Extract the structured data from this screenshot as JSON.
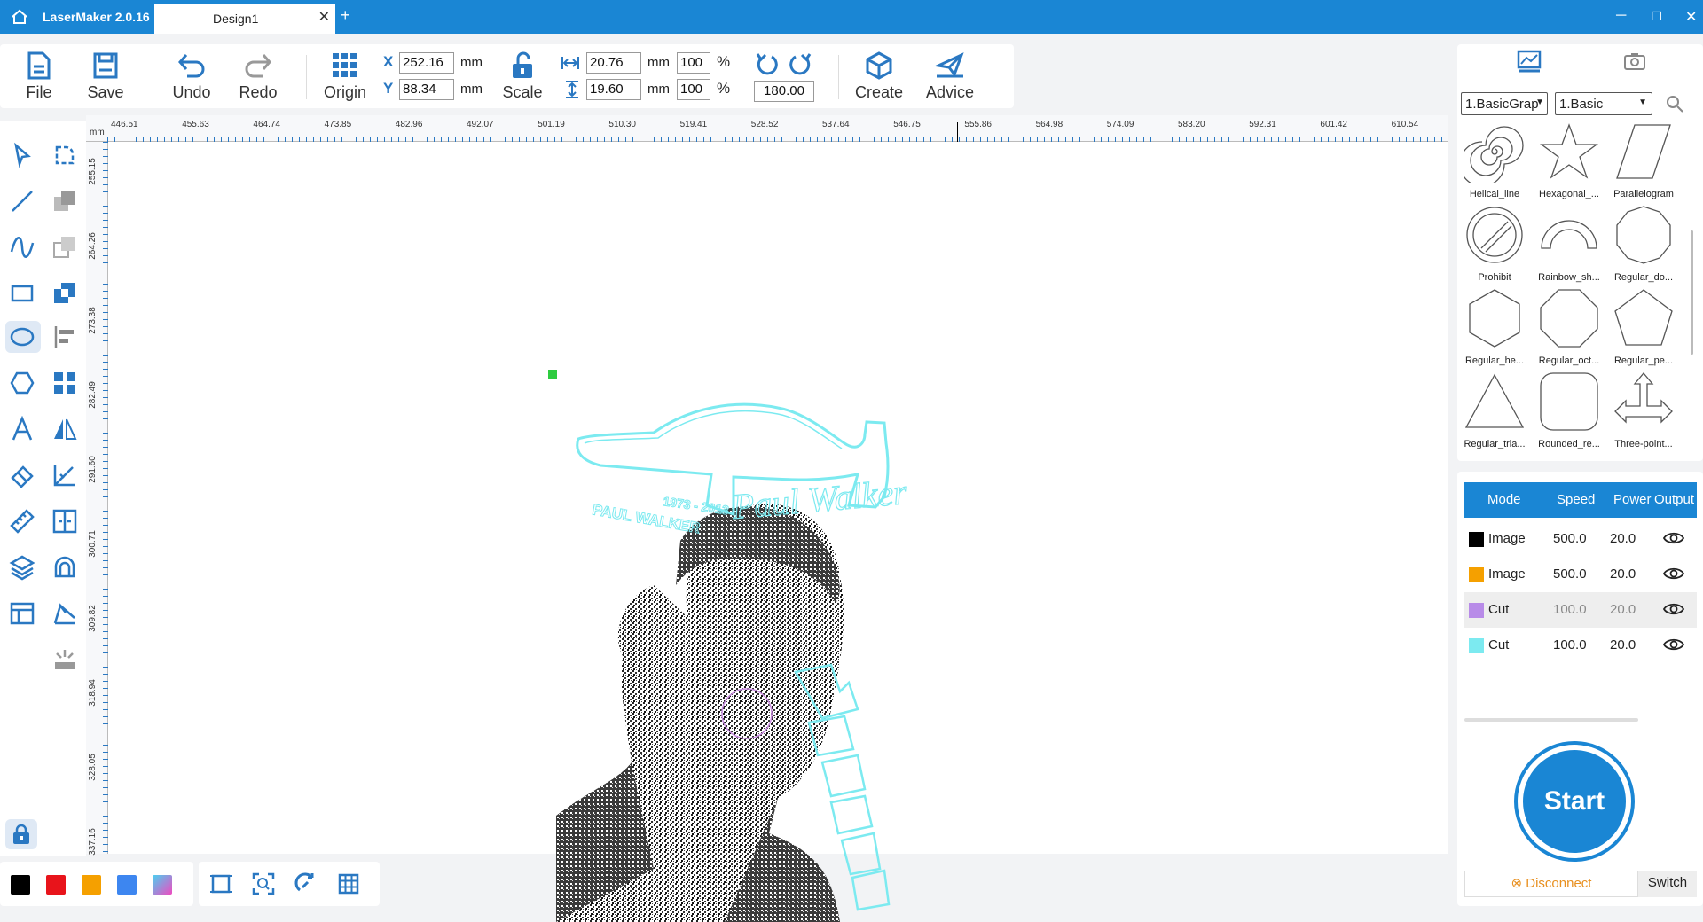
{
  "window": {
    "app_title": "LaserMaker 2.0.16",
    "tab_name": "Design1"
  },
  "toolbar": {
    "file": "File",
    "save": "Save",
    "undo": "Undo",
    "redo": "Redo",
    "origin": "Origin",
    "scale": "Scale",
    "create": "Create",
    "advice": "Advice",
    "x_label": "X",
    "y_label": "Y",
    "x_value": "252.16",
    "y_value": "88.34",
    "unit": "mm",
    "width_value": "20.76",
    "height_value": "19.60",
    "width_pct": "100",
    "height_pct": "100",
    "pct": "%",
    "rotation": "180.00"
  },
  "ruler": {
    "top": [
      "446.51",
      "455.63",
      "464.74",
      "473.85",
      "482.96",
      "492.07",
      "501.19",
      "510.30",
      "519.41",
      "528.52",
      "537.64",
      "546.75",
      "555.86",
      "564.98",
      "574.09",
      "583.20",
      "592.31",
      "601.42",
      "610.54"
    ],
    "left": [
      "255.15",
      "264.26",
      "273.38",
      "282.49",
      "291.60",
      "300.71",
      "309.82",
      "318.94",
      "328.05",
      "337.16"
    ],
    "unit": "mm"
  },
  "canvas": {
    "text_lines": [
      "1973 - 2013",
      "PAUL WALKER"
    ],
    "signature": "Paul Walker"
  },
  "library": {
    "category": "1.BasicGrap",
    "subcategory": "1.Basic",
    "shapes": [
      "Helical_line",
      "Hexagonal_...",
      "Parallelogram",
      "Prohibit",
      "Rainbow_sh...",
      "Regular_do...",
      "Regular_he...",
      "Regular_oct...",
      "Regular_pe...",
      "Regular_tria...",
      "Rounded_re...",
      "Three-point..."
    ]
  },
  "layers": {
    "headers": {
      "mode": "Mode",
      "speed": "Speed",
      "power": "Power",
      "output": "Output"
    },
    "rows": [
      {
        "color": "#000000",
        "mode": "Image",
        "speed": "500.0",
        "power": "20.0"
      },
      {
        "color": "#f5a000",
        "mode": "Image",
        "speed": "500.0",
        "power": "20.0"
      },
      {
        "color": "#b88be8",
        "mode": "Cut",
        "speed": "100.0",
        "power": "20.0"
      },
      {
        "color": "#7ceaf0",
        "mode": "Cut",
        "speed": "100.0",
        "power": "20.0"
      }
    ]
  },
  "actions": {
    "start": "Start",
    "disconnect": "Disconnect",
    "switch": "Switch"
  },
  "palette": [
    "#000000",
    "#e8141b",
    "#f5a000",
    "#3d86f0",
    "gradient"
  ]
}
